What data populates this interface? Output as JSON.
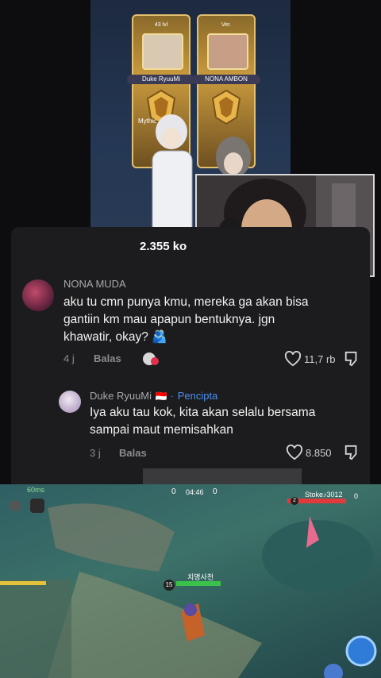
{
  "profile_art": {
    "left_banner": {
      "level": "43 lvl",
      "name": "Duke RyuuMi",
      "rank": "Mythic"
    },
    "right_banner": {
      "level": "Ver.",
      "name": "NONA AMBON"
    }
  },
  "comments_header": {
    "count": "2.355 ko"
  },
  "comments": [
    {
      "username": "NONA MUDA",
      "text_lines": [
        "aku tu cmn punya kmu, mereka ga akan bisa",
        "gantiin km mau apapun bentuknya. jgn",
        "khawatir, okay? 🫂"
      ],
      "time": "4 j",
      "reply_label": "Balas",
      "likes": "11,7 rb"
    },
    {
      "username": "Duke RyuuMi",
      "flag": "🇮🇩",
      "separator": "·",
      "badge": "Pencipta",
      "text_lines": [
        "Iya aku tau kok, kita akan selalu bersama",
        "sampai maut memisahkan"
      ],
      "time": "3 j",
      "reply_label": "Balas",
      "likes": "8.850"
    }
  ],
  "game_hud": {
    "ping": "60ms",
    "score_left": "0",
    "timer": "04:46",
    "score_right": "0",
    "enemy_name": "Stoke♪3012",
    "enemy_level": "2",
    "kills": "0",
    "player_level": "15",
    "player_name": "치명사천"
  },
  "colors": {
    "panel_bg": "#1c1c1e",
    "accent_blue": "#4b8ff0",
    "gold": "#c99a3e"
  }
}
